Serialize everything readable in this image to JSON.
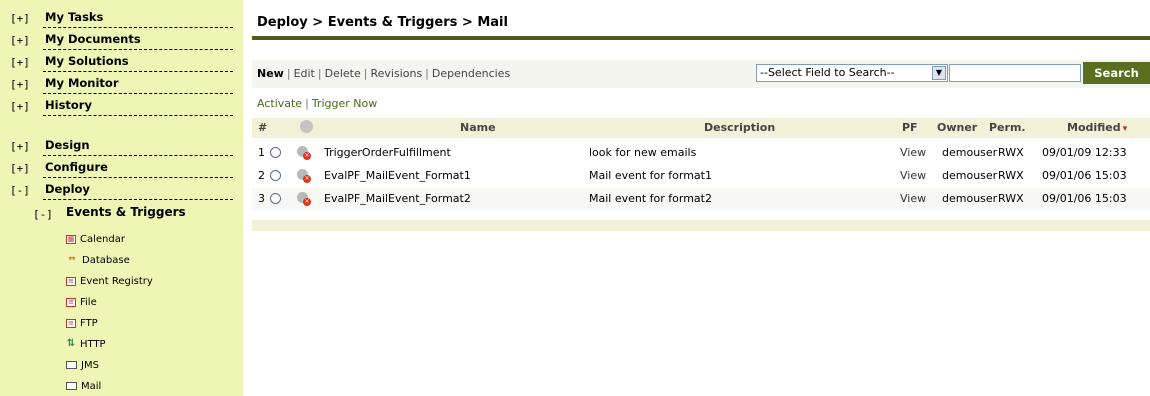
{
  "sidebar": {
    "top_items": [
      {
        "toggle": "[+]",
        "label": "My Tasks"
      },
      {
        "toggle": "[+]",
        "label": "My Documents"
      },
      {
        "toggle": "[+]",
        "label": "My Solutions"
      },
      {
        "toggle": "[+]",
        "label": "My Monitor"
      },
      {
        "toggle": "[+]",
        "label": "History"
      }
    ],
    "sections": [
      {
        "toggle": "[+]",
        "label": "Design"
      },
      {
        "toggle": "[+]",
        "label": "Configure"
      },
      {
        "toggle": "[-]",
        "label": "Deploy"
      }
    ],
    "subsection": {
      "toggle": "[-]",
      "label": "Events & Triggers"
    },
    "leaves": [
      {
        "icon": "calendar-icon",
        "label": "Calendar"
      },
      {
        "icon": "database-icon",
        "label": "Database"
      },
      {
        "icon": "event-registry-icon",
        "label": "Event Registry"
      },
      {
        "icon": "file-icon",
        "label": "File"
      },
      {
        "icon": "ftp-icon",
        "label": "FTP"
      },
      {
        "icon": "http-icon",
        "label": "HTTP"
      },
      {
        "icon": "envelope-icon",
        "label": "JMS"
      },
      {
        "icon": "envelope-icon",
        "label": "Mail"
      }
    ]
  },
  "header": {
    "title": "Deploy > Events & Triggers > Mail"
  },
  "toolbar": {
    "new": "New",
    "edit": "Edit",
    "delete": "Delete",
    "revisions": "Revisions",
    "dependencies": "Dependencies",
    "separator": "|",
    "field_select": "--Select Field to Search--",
    "search_value": "",
    "search_button": "Search"
  },
  "sub_actions": {
    "activate": "Activate",
    "trigger_now": "Trigger Now",
    "separator": "|"
  },
  "table": {
    "columns": {
      "num": "#",
      "name": "Name",
      "description": "Description",
      "pf": "PF",
      "owner": "Owner",
      "perm": "Perm.",
      "modified": "Modified"
    },
    "sort_indicator": "▾",
    "rows": [
      {
        "num": "1",
        "name": "TriggerOrderFulfillment",
        "description": "look for new emails",
        "pf": "View",
        "owner": "demouser",
        "perm": "RWX",
        "modified": "09/01/09 12:33"
      },
      {
        "num": "2",
        "name": "EvalPF_MailEvent_Format1",
        "description": "Mail event for format1",
        "pf": "View",
        "owner": "demouser",
        "perm": "RWX",
        "modified": "09/01/06 15:03"
      },
      {
        "num": "3",
        "name": "EvalPF_MailEvent_Format2",
        "description": "Mail event for format2",
        "pf": "View",
        "owner": "demouser",
        "perm": "RWX",
        "modified": "09/01/06 15:03"
      }
    ]
  },
  "colors": {
    "sidebar_bg": "#eef5b5",
    "accent": "#4d5a1b",
    "search_button": "#5a6e1f",
    "header_row": "#f0f1d6"
  }
}
